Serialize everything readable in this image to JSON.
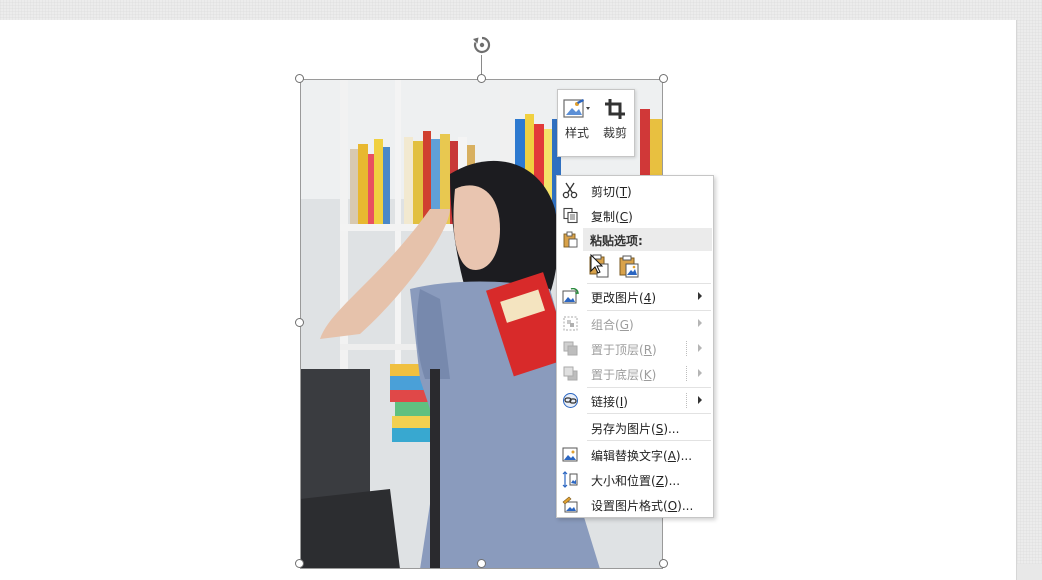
{
  "mini_toolbar": {
    "style_label": "样式",
    "crop_label": "裁剪"
  },
  "context_menu": {
    "cut": {
      "label": "剪切(",
      "key": "T",
      "end": ")"
    },
    "copy": {
      "label": "复制(",
      "key": "C",
      "end": ")"
    },
    "paste_options_header": "粘贴选项:",
    "change_picture": {
      "label": "更改图片(",
      "key": "4",
      "end": ")"
    },
    "group": {
      "label": "组合(",
      "key": "G",
      "end": ")"
    },
    "bring_to_front": {
      "label": "置于顶层(",
      "key": "R",
      "end": ")"
    },
    "send_to_back": {
      "label": "置于底层(",
      "key": "K",
      "end": ")"
    },
    "link": {
      "label": "链接(",
      "key": "I",
      "end": ")"
    },
    "save_as_picture": {
      "label": "另存为图片(",
      "key": "S",
      "end": ")..."
    },
    "edit_alt_text": {
      "label": "编辑替换文字(",
      "key": "A",
      "end": ")..."
    },
    "size_position": {
      "label": "大小和位置(",
      "key": "Z",
      "end": ")..."
    },
    "format_picture": {
      "label": "设置图片格式(",
      "key": "O",
      "end": ")..."
    }
  },
  "colors": {
    "menu_header_bg": "#ebebeb",
    "disabled_text": "#9c9c9c",
    "accent_blue": "#2b66c2",
    "accent_orange": "#e0a030"
  }
}
